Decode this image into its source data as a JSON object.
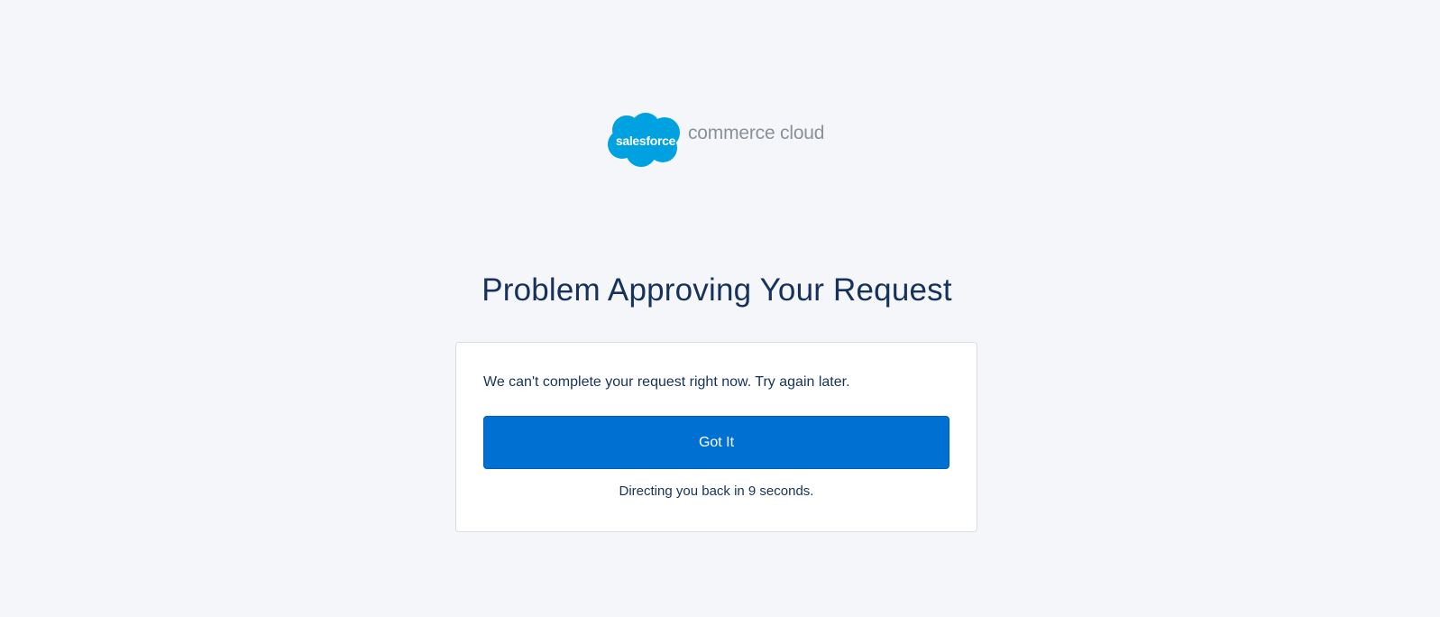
{
  "logo": {
    "cloud_text": "salesforce",
    "product_text": "commerce cloud",
    "cloud_color": "#00a1e0"
  },
  "title": "Problem Approving Your Request",
  "card": {
    "message": "We can't complete your request right now. Try again later.",
    "button_label": "Got It",
    "countdown": "Directing you back in 9 seconds."
  },
  "colors": {
    "background": "#f4f6f9",
    "text": "#16325c",
    "button": "#0070d2"
  }
}
